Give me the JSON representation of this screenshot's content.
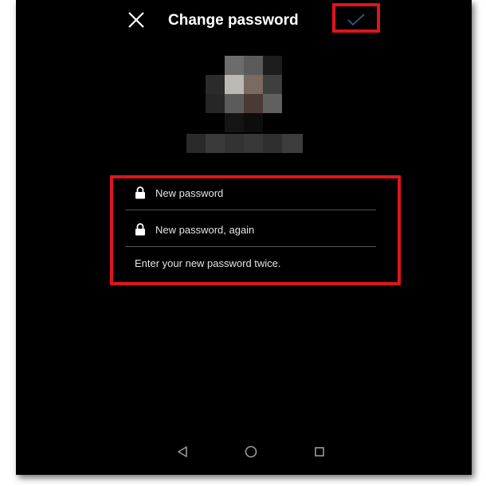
{
  "header": {
    "title": "Change password",
    "close_icon": "close-icon",
    "confirm_icon": "checkmark-icon"
  },
  "profile": {
    "avatar": "pixelated-profile-photo",
    "username": "pixelated-username"
  },
  "form": {
    "new_password_placeholder": "New password",
    "new_password_again_placeholder": "New password, again",
    "hint": "Enter your new password twice.",
    "field_icon": "lock-icon"
  },
  "nav_bar": {
    "back_icon": "back-triangle-icon",
    "home_icon": "home-circle-icon",
    "recents_icon": "recents-square-icon"
  },
  "colors": {
    "background": "#000000",
    "text": "#ffffff",
    "highlight": "#e0141b",
    "confirm_check": "#2d4f7a",
    "divider": "#555555"
  }
}
